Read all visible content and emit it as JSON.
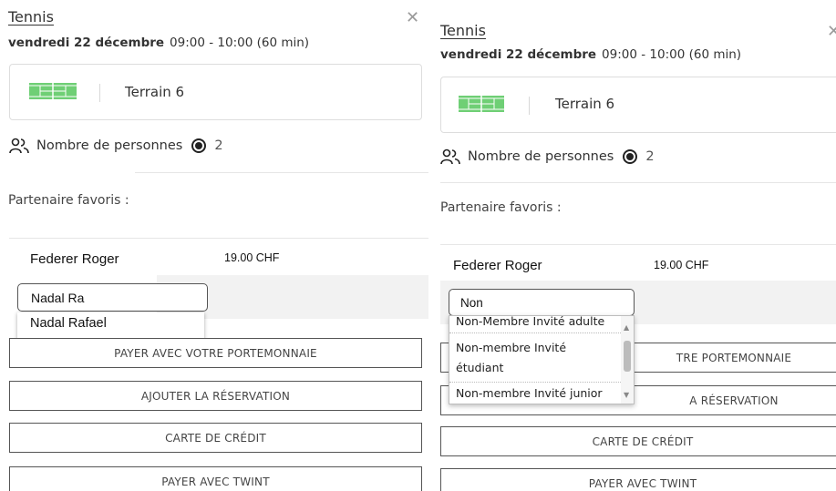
{
  "left": {
    "title": "Tennis",
    "date": "vendredi 22 décembre",
    "time": "09:00 - 10:00 (60 min)",
    "court": "Terrain 6",
    "people_label": "Nombre de personnes",
    "people_count": "2",
    "partners_label": "Partenaire favoris :",
    "player_name": "Federer Roger",
    "player_price": "19.00 CHF",
    "search_value": "Nadal Ra",
    "suggestion": "Nadal Rafael",
    "buttons": {
      "wallet": "PAYER AVEC VOTRE PORTEMONNAIE",
      "add": "AJOUTER LA RÉSERVATION",
      "card": "CARTE DE CRÉDIT",
      "twint": "PAYER AVEC TWINT"
    }
  },
  "right": {
    "title": "Tennis",
    "date": "vendredi 22 décembre",
    "time": "09:00 - 10:00 (60 min)",
    "court": "Terrain 6",
    "people_label": "Nombre de personnes",
    "people_count": "2",
    "partners_label": "Partenaire favoris :",
    "player_name": "Federer Roger",
    "player_price": "19.00 CHF",
    "search_value": "Non",
    "options": [
      "Non-Membre Invité adulte",
      "Non-membre Invité",
      "étudiant",
      "Non-membre Invité junior"
    ],
    "buttons": {
      "wallet_partial": "TRE PORTEMONNAIE",
      "add_partial": "A RÉSERVATION",
      "card": "CARTE DE CRÉDIT",
      "twint": "PAYER AVEC TWINT"
    }
  },
  "icons": {
    "close": "close-icon",
    "court": "tennis-court-icon",
    "people": "people-icon",
    "radio": "radio-selected-icon",
    "scroll_up": "scroll-up-arrow-icon",
    "scroll_down": "scroll-down-arrow-icon"
  },
  "colors": {
    "court_green": "#6fcf75",
    "text": "#333333",
    "border": "#555555"
  }
}
